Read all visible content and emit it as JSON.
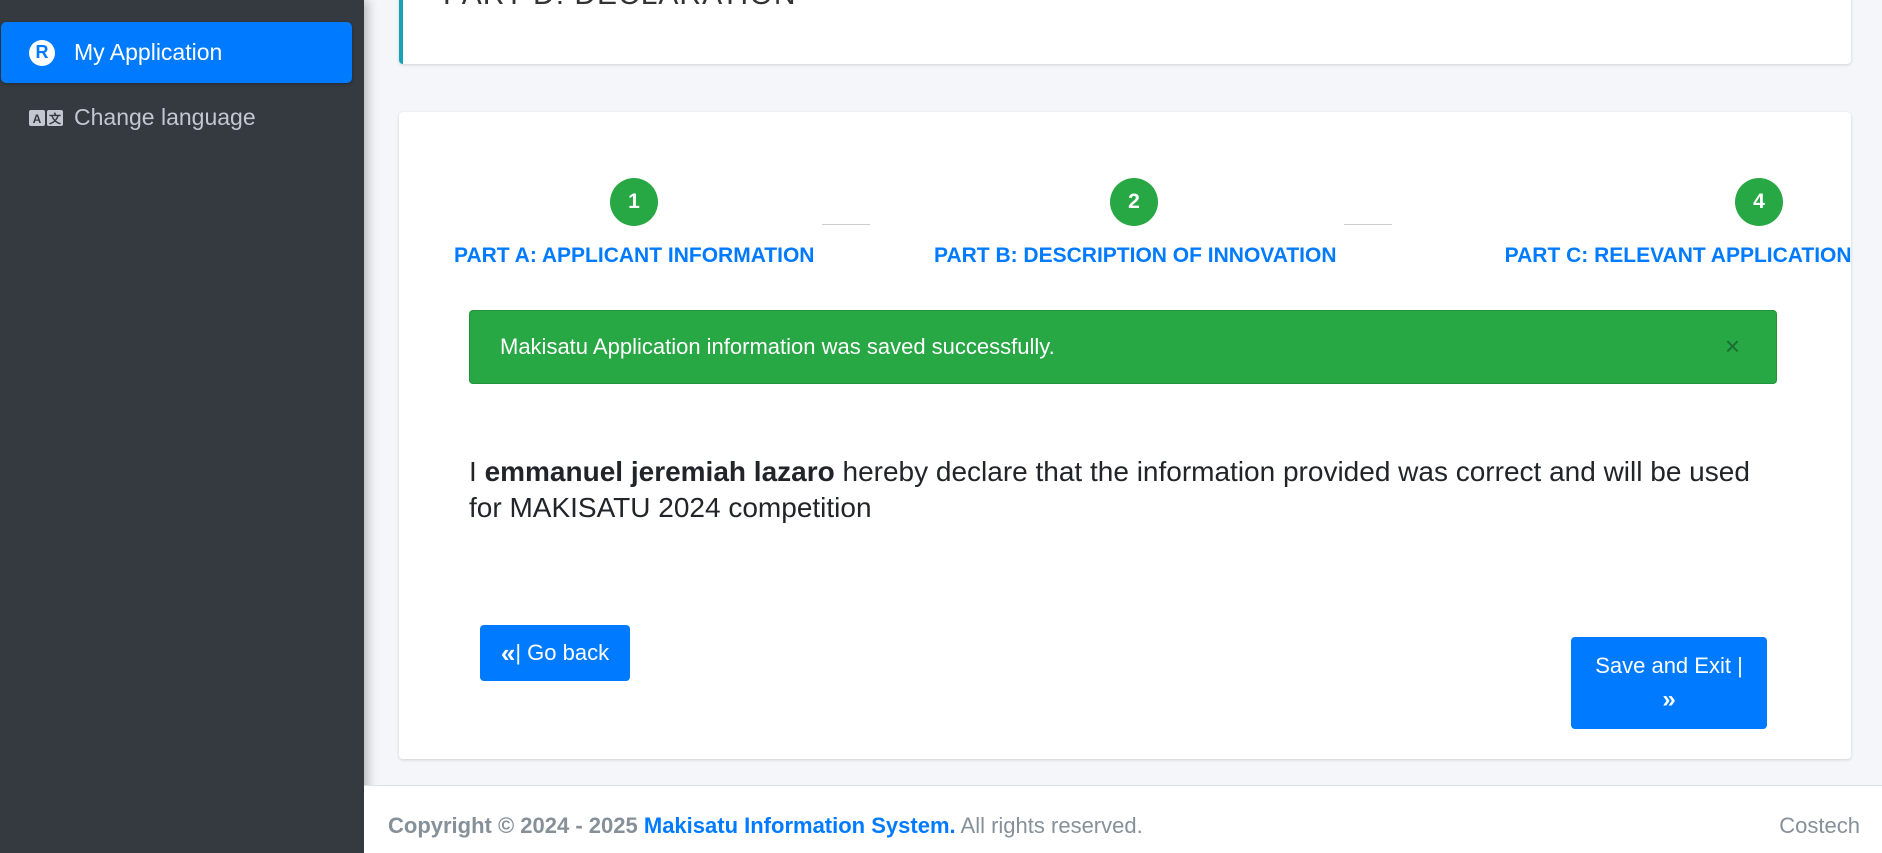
{
  "sidebar": {
    "items": [
      {
        "label": "My Application",
        "icon": "registered-icon",
        "active": true
      },
      {
        "label": "Change language",
        "icon": "translate-icon",
        "active": false
      }
    ]
  },
  "header": {
    "title": "PART D: DECLARATION"
  },
  "stepper": {
    "steps": [
      {
        "number": "1",
        "label": "PART A: APPLICANT INFORMATION"
      },
      {
        "number": "2",
        "label": "PART B: DESCRIPTION OF INNOVATION"
      },
      {
        "number": "4",
        "label": "PART C: RELEVANT APPLICATION ATTACHMENTS"
      }
    ]
  },
  "alert": {
    "message": "Makisatu Application information was saved successfully.",
    "close": "×"
  },
  "declaration": {
    "prefix": "I",
    "name": "emmanuel jeremiah lazaro",
    "suffix": "hereby declare that the information provided was correct and will be used for MAKISATU 2024 competition"
  },
  "buttons": {
    "back_icon": "«",
    "back_label": "| Go back",
    "save_label": "Save and Exit |",
    "save_icon": "»"
  },
  "footer": {
    "copyright": "Copyright © 2024 - 2025",
    "brand": "Makisatu Information System.",
    "rights": "All rights reserved.",
    "right_text": "Costech"
  },
  "colors": {
    "primary": "#007bff",
    "success": "#28a745",
    "sidebar_bg": "#343a40"
  }
}
